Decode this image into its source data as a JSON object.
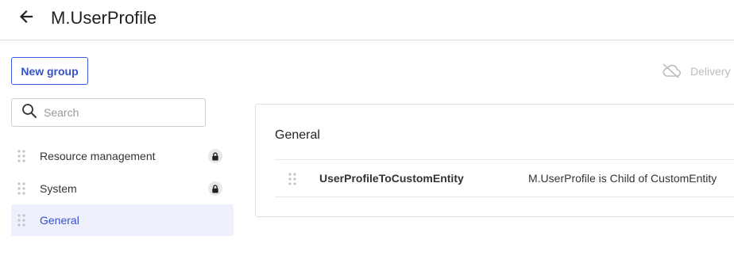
{
  "header": {
    "title": "M.UserProfile",
    "back_icon": "arrow-left-icon"
  },
  "toolbar": {
    "new_group_label": "New group",
    "delivery_label": "Delivery",
    "delivery_icon": "cloud-off-icon"
  },
  "search": {
    "placeholder": "Search",
    "value": ""
  },
  "sidebar": {
    "items": [
      {
        "label": "Resource management",
        "locked": true,
        "active": false
      },
      {
        "label": "System",
        "locked": true,
        "active": false
      },
      {
        "label": "General",
        "locked": false,
        "active": true
      }
    ]
  },
  "main": {
    "group_title": "General",
    "relations": [
      {
        "name": "UserProfileToCustomEntity",
        "description": "M.UserProfile is Child of CustomEntity"
      }
    ]
  },
  "colors": {
    "accent": "#3451c7",
    "active_bg": "#eef0fd",
    "muted": "#bdbdbd"
  }
}
